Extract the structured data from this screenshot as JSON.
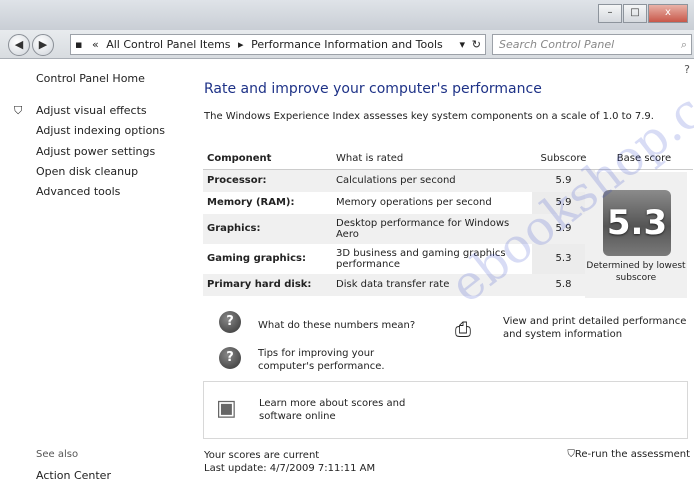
{
  "window": {
    "min_label": "–",
    "max_label": "□",
    "close_label": "x"
  },
  "nav": {
    "back": "◀",
    "forward": "▶",
    "breadcrumb": [
      "All Control Panel Items",
      "Performance Information and Tools"
    ],
    "breadcrumb_prefix": "«",
    "search_placeholder": "Search Control Panel"
  },
  "sidebar": {
    "home": "Control Panel Home",
    "links": [
      "Adjust visual effects",
      "Adjust indexing options",
      "Adjust power settings",
      "Open disk cleanup",
      "Advanced tools"
    ],
    "see_also": "See also",
    "action_center": "Action Center"
  },
  "main": {
    "title": "Rate and improve your computer's performance",
    "description": "The Windows Experience Index assesses key system components on a scale of 1.0 to 7.9.",
    "table": {
      "headers": [
        "Component",
        "What is rated",
        "Subscore",
        "Base score"
      ],
      "rows": [
        {
          "component": "Processor:",
          "rated": "Calculations per second",
          "subscore": "5.9"
        },
        {
          "component": "Memory (RAM):",
          "rated": "Memory operations per second",
          "subscore": "5.9"
        },
        {
          "component": "Graphics:",
          "rated": "Desktop performance for Windows Aero",
          "subscore": "5.9"
        },
        {
          "component": "Gaming graphics:",
          "rated": "3D business and gaming graphics performance",
          "subscore": "5.3"
        },
        {
          "component": "Primary hard disk:",
          "rated": "Disk data transfer rate",
          "subscore": "5.8"
        }
      ]
    },
    "base_score": "5.3",
    "base_caption": "Determined by lowest subscore",
    "help": {
      "numbers": "What do these numbers mean?",
      "tips": "Tips for improving your computer's performance.",
      "print": "View and print detailed performance and system information"
    },
    "learn_more": "Learn more about scores and software online",
    "status_line1": "Your scores are current",
    "status_line2": "Last update: 4/7/2009 7:11:11 AM",
    "rerun": "Re-run the assessment",
    "watermark": "ebookshop.com"
  }
}
